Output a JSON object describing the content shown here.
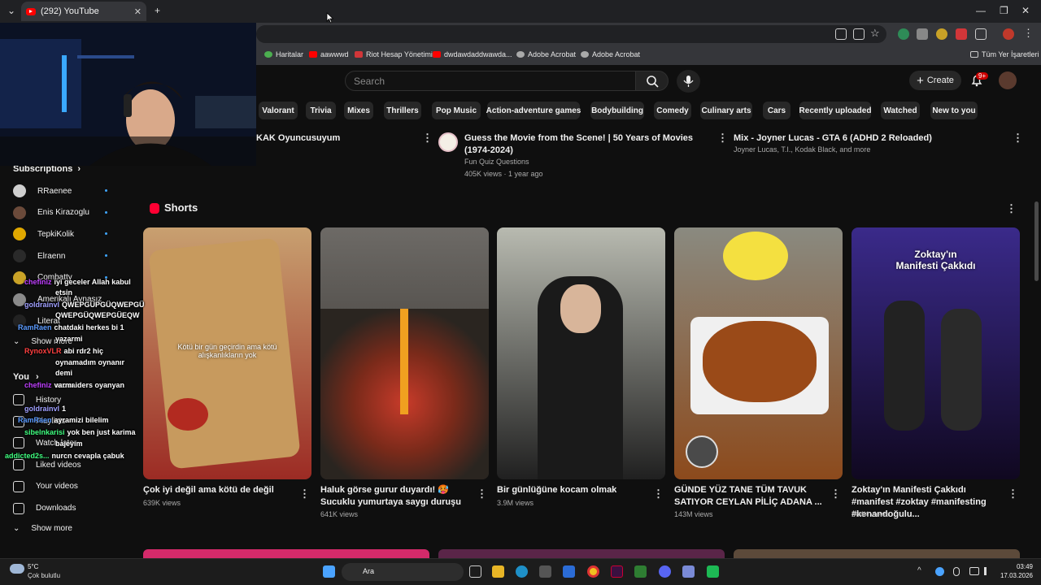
{
  "browser": {
    "tab_title": "(292) YouTube",
    "bookmarks": [
      {
        "label": "Haritalar",
        "color": "#4caf50"
      },
      {
        "label": "aawwwd",
        "color": "#ff0000"
      },
      {
        "label": "Riot Hesap Yönetimi",
        "color": "#d13639"
      },
      {
        "label": "dwdawdaddwawda...",
        "color": "#ff0000"
      },
      {
        "label": "Adobe Acrobat",
        "color": "#aaaaaa"
      },
      {
        "label": "Adobe Acrobat",
        "color": "#aaaaaa"
      }
    ],
    "all_bookmarks": "Tüm Yer İşaretleri"
  },
  "header": {
    "search_placeholder": "Search",
    "create_label": "Create",
    "notif_count": "9+"
  },
  "chips": [
    "Valorant",
    "Trivia",
    "Mixes",
    "Thrillers",
    "Pop Music",
    "Action-adventure games",
    "Bodybuilding",
    "Comedy",
    "Culinary arts",
    "Cars",
    "Recently uploaded",
    "Watched",
    "New to you"
  ],
  "top_videos": [
    {
      "title": "KAK Oyuncusuyum"
    },
    {
      "title": "Guess the Movie from the Scene! | 50 Years of Movies (1974-2024)",
      "channel": "Fun Quiz Questions",
      "meta": "405K views · 1 year ago"
    },
    {
      "title": "Mix - Joyner Lucas - GTA 6 (ADHD 2 Reloaded)",
      "channel": "Joyner Lucas, T.I., Kodak Black, and more"
    }
  ],
  "sidebar": {
    "subscriptions_label": "Subscriptions",
    "subs": [
      {
        "name": "RRaenee",
        "color": "#cfcfcf"
      },
      {
        "name": "Enis Kirazoglu",
        "color": "#6b4a3a"
      },
      {
        "name": "TepkiKolik",
        "color": "#e0a800"
      },
      {
        "name": "Elraenn",
        "color": "#2a2a2a"
      },
      {
        "name": "Combatty",
        "color": "#c9a227"
      },
      {
        "name": "Amerikalı Aynasız",
        "color": "#8a8a8a"
      },
      {
        "name": "Literat",
        "color": "#222222"
      }
    ],
    "show_more": "Show more",
    "you_label": "You",
    "you_items": [
      "History",
      "Playlists",
      "Watch later",
      "Liked videos",
      "Your videos",
      "Downloads"
    ],
    "show_more_2": "Show more"
  },
  "chat": [
    {
      "user": "chefiniz",
      "ucolor": "#c040ff",
      "msg": "iyi geceler Allah kabul"
    },
    {
      "user": "",
      "ucolor": "#ffffff",
      "msg": "etsin"
    },
    {
      "user": "goldrainvl",
      "ucolor": "#a0a0ff",
      "msg": "QWEPGÜPGÜQWEPGÜ"
    },
    {
      "user": "",
      "ucolor": "#ffffff",
      "msg": "QWEPGÜQWEPGÜEQW"
    },
    {
      "user": "RamRaen",
      "ucolor": "#5b9bff",
      "msg": "chatdaki herkes bi 1"
    },
    {
      "user": "",
      "ucolor": "#ffffff",
      "msg": "yazarmi"
    },
    {
      "user": "RynoxVLR",
      "ucolor": "#ff4040",
      "msg": "abi rdr2 hiç"
    },
    {
      "user": "",
      "ucolor": "#ffffff",
      "msg": "oynamadım oynanır"
    },
    {
      "user": "",
      "ucolor": "#ffffff",
      "msg": "demi"
    },
    {
      "user": "",
      "ucolor": "#ffffff",
      "msg": "arc raiders oyanyan"
    },
    {
      "user": "chefiniz",
      "ucolor": "#c040ff",
      "msg": "varmı"
    },
    {
      "user": "",
      "ucolor": "#ffffff",
      "msg": "varmı"
    },
    {
      "user": "goldrainvl",
      "ucolor": "#a0a0ff",
      "msg": "1"
    },
    {
      "user": "RamRaen",
      "ucolor": "#5b9bff",
      "msg": "ayramizi bilelim"
    },
    {
      "user": "sibelnkarisi",
      "ucolor": "#40ff80",
      "msg": "yok ben just karima"
    },
    {
      "user": "",
      "ucolor": "#ffffff",
      "msg": "bajeyım"
    },
    {
      "user": "addicted2s...",
      "ucolor": "#40ff80",
      "msg": "nurcn cevapla çabuk"
    }
  ],
  "shorts_label": "Shorts",
  "shorts": [
    {
      "title": "Çok iyi değil ama kötü de değil",
      "views": "639K views",
      "overlay": "Kötü bir gün geçirdin ama kötü alışkanlıkların yok",
      "colors": [
        "#c8a070",
        "#9c2b24"
      ]
    },
    {
      "title": "Haluk görse gurur duyardı! 🥵 Sucuklu yumurtaya saygı duruşu",
      "views": "641K views",
      "overlay": "",
      "colors": [
        "#6d6a66",
        "#2e2a26"
      ]
    },
    {
      "title": "Bir günlüğüne kocam olmak",
      "views": "3.9M views",
      "overlay": "",
      "colors": [
        "#b8bab0",
        "#202020"
      ]
    },
    {
      "title": "GÜNDE YÜZ TANE TÜM TAVUK SATIYOR CEYLAN PİLİÇ ADANA ...",
      "views": "143M views",
      "overlay": "",
      "colors": [
        "#8a8a80",
        "#8c4a1c"
      ]
    },
    {
      "title": "Zoktay'ın Manifesti Çakkıdı #manifest #zoktay #manifesting #kenandoğulu...",
      "views": "564K views",
      "overlay": "Zoktay'ın Manifesti Çakkıdı",
      "colors": [
        "#3a2a8a",
        "#100820"
      ]
    }
  ],
  "taskbar": {
    "weather_temp": "5°C",
    "weather_desc": "Çok bulutlu",
    "search_label": "Ara",
    "time": "03:49",
    "date": "17.03.2026"
  }
}
